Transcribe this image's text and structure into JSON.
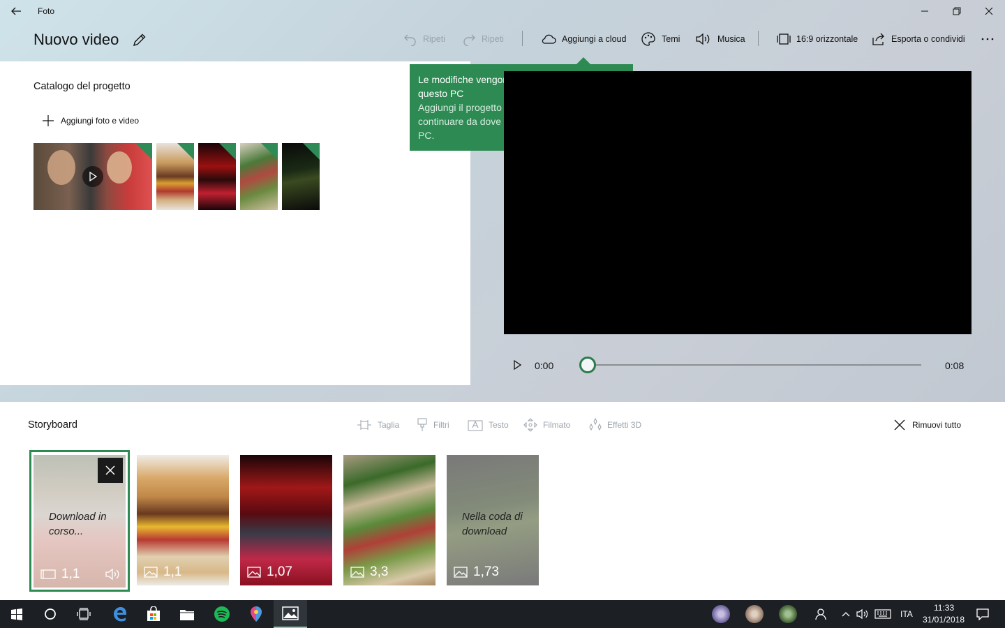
{
  "window": {
    "app_title": "Foto"
  },
  "header": {
    "project_title": "Nuovo video"
  },
  "toolbar": {
    "undo_label": "Ripeti",
    "redo_label": "Ripeti",
    "cloud_label": "Aggiungi a cloud",
    "themes_label": "Temi",
    "music_label": "Musica",
    "aspect_label": "16:9 orizzontale",
    "export_label": "Esporta o condividi"
  },
  "tooltip": {
    "title": "Le modifiche vengono già salvate su questo PC",
    "body": "Aggiungi il progetto video al cloud per poter continuare da dove hai lasciato su un altro PC."
  },
  "catalog": {
    "title": "Catalogo del progetto",
    "add_label": "Aggiungi foto e video"
  },
  "player": {
    "current_time": "0:00",
    "total_time": "0:08",
    "progress": 0.0
  },
  "storyboard": {
    "title": "Storyboard",
    "tools": {
      "trim": "Taglia",
      "filters": "Filtri",
      "text": "Testo",
      "motion": "Filmato",
      "effects3d": "Effetti 3D"
    },
    "remove_all": "Rimuovi tutto",
    "cards": [
      {
        "duration": "1,1",
        "status": "Download in corso..."
      },
      {
        "duration": "1,1"
      },
      {
        "duration": "1,07"
      },
      {
        "duration": "3,3"
      },
      {
        "duration": "1,73",
        "status": "Nella coda di download"
      }
    ]
  },
  "taskbar": {
    "language": "ITA",
    "time": "11:33",
    "date": "31/01/2018"
  },
  "colors": {
    "accent": "#2c8a52",
    "taskbar": "#1c1f24"
  }
}
